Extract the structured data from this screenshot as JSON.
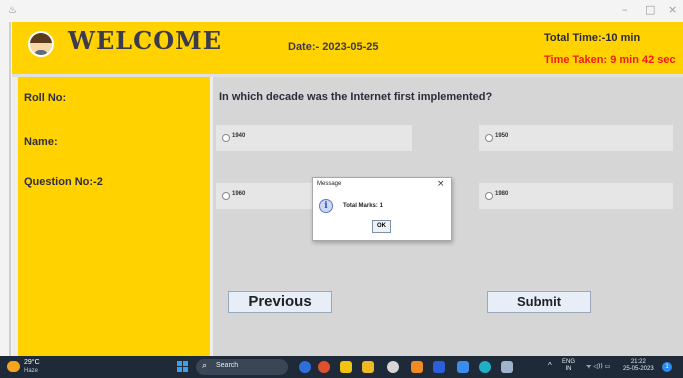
{
  "header": {
    "title": "WELCOME",
    "date": "Date:- 2023-05-25",
    "total_time": "Total Time:-10 min",
    "time_taken": "Time Taken: 9 min 42 sec"
  },
  "sidebar": {
    "roll_label": "Roll No:",
    "name_label": "Name:",
    "question_no_label": "Question No:-2"
  },
  "question": {
    "text": "In which decade was the Internet first implemented?",
    "options": [
      "1940",
      "1950",
      "1960",
      "1980"
    ]
  },
  "buttons": {
    "previous": "Previous",
    "submit": "Submit"
  },
  "dialog": {
    "title": "Message",
    "message": "Total Marks: 1",
    "ok": "OK",
    "close": "×",
    "info_glyph": "i"
  },
  "window_controls": {
    "minimize": "–",
    "maximize": "□",
    "close": "×"
  },
  "taskbar": {
    "temperature": "29°C",
    "weather": "Haze",
    "search_placeholder": "Search",
    "search_glyph": "⌕",
    "tray_caret": "^",
    "language_top": "ENG",
    "language_bottom": "IN",
    "system_icons": "ᯤ ◁)) ▭",
    "time": "21:22",
    "date": "25-05-2023",
    "notification_count": "1"
  },
  "colors": {
    "header_bg": "#ffd200",
    "time_taken": "#f31b1b",
    "panel_bg": "#d6d6d6",
    "taskbar_bg": "#1e2a38"
  }
}
